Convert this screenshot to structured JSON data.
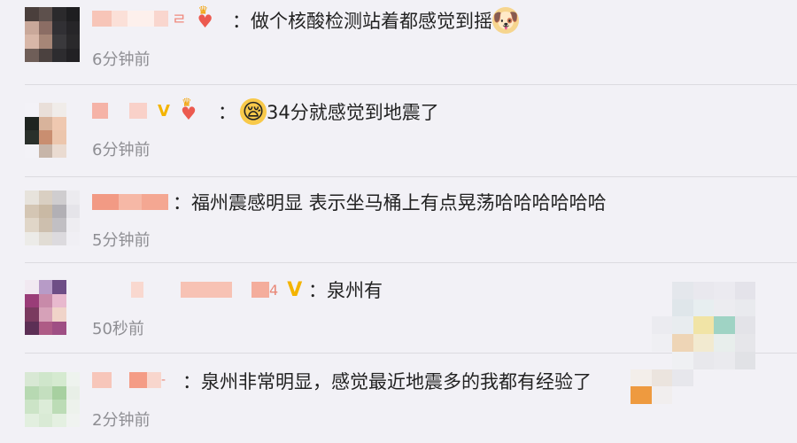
{
  "comments": [
    {
      "content": "：做个核酸检测站着都感觉到摇",
      "emoji": "🐶",
      "time": "6分钟前"
    },
    {
      "content": "34分就感觉到地震了",
      "emoji": "😪",
      "time": "6分钟前"
    },
    {
      "content": "：福州震感明显 表示坐马桶上有点晃荡哈哈哈哈哈哈",
      "time": "5分钟前"
    },
    {
      "content": "：泉州有",
      "vip": "V",
      "time": "50秒前"
    },
    {
      "content": "：泉州非常明显，感觉最近地震多的我都有经验了",
      "time": "2分钟前"
    }
  ],
  "colors": {
    "background": "#f2f1f6",
    "text": "#222222",
    "timestamp": "#8e8e93",
    "vip_gold": "#f4b400"
  },
  "icons": [
    "crown-heart-badge-icon",
    "vip-v-icon",
    "dog-emoji-icon",
    "sleepy-emoji-icon"
  ]
}
